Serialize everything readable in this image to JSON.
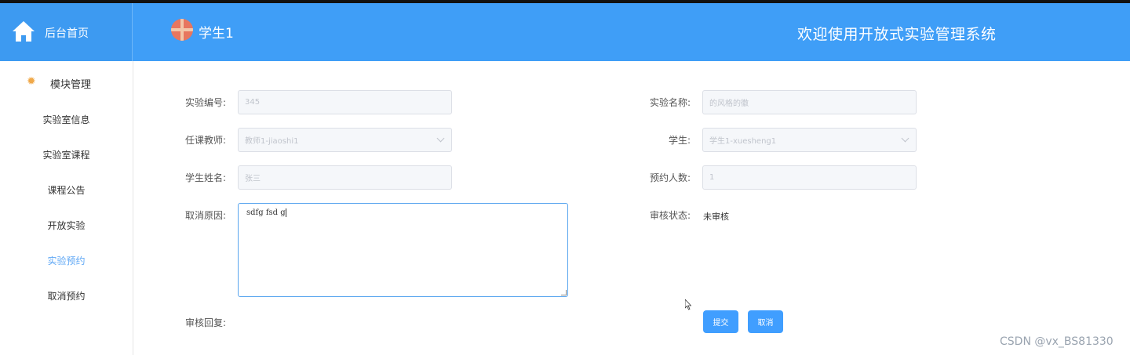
{
  "header": {
    "home_label": "后台首页",
    "user_name": "学生1",
    "welcome": "欢迎使用开放式实验管理系统"
  },
  "sidebar": {
    "group_label": "模块管理",
    "items": [
      {
        "label": "实验室信息"
      },
      {
        "label": "实验室课程"
      },
      {
        "label": "课程公告"
      },
      {
        "label": "开放实验"
      },
      {
        "label": "实验预约"
      },
      {
        "label": "取消预约"
      }
    ],
    "active_index": 4
  },
  "form": {
    "exp_no": {
      "label": "实验编号:",
      "value": "345"
    },
    "exp_name": {
      "label": "实验名称:",
      "value": "的风格的徽"
    },
    "teacher": {
      "label": "任课教师:",
      "value": "教师1-jiaoshi1"
    },
    "student": {
      "label": "学生:",
      "value": "学生1-xuesheng1"
    },
    "student_name": {
      "label": "学生姓名:",
      "value": "张三"
    },
    "headcount": {
      "label": "预约人数:",
      "value": "1"
    },
    "cancel_reason": {
      "label": "取消原因:",
      "value": "sdfg fsd g"
    },
    "audit_status": {
      "label": "审核状态:",
      "value": "未审核"
    },
    "audit_reply": {
      "label": "审核回复:",
      "value": ""
    }
  },
  "buttons": {
    "submit": "提交",
    "cancel": "取消"
  },
  "watermark": "CSDN @vx_BS81330",
  "colors": {
    "header_bg": "#3f9ef7",
    "primary_button": "#409eff",
    "active_menu": "#60a8f5"
  }
}
